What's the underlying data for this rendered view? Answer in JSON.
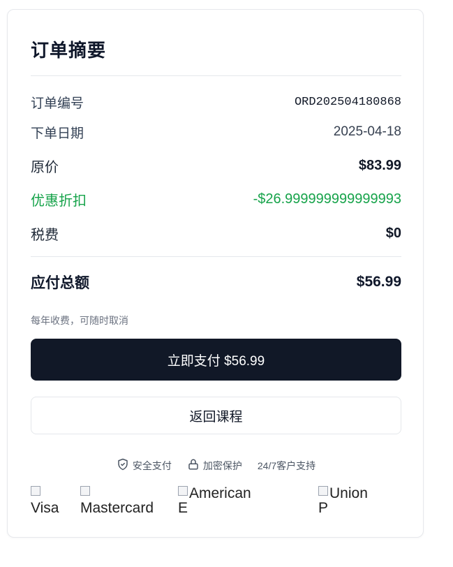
{
  "summary": {
    "title": "订单摘要",
    "rows": [
      {
        "label": "订单编号",
        "value": "ORD202504180868"
      },
      {
        "label": "下单日期",
        "value": "2025-04-18"
      },
      {
        "label": "原价",
        "value": "$83.99"
      },
      {
        "label": "优惠折扣",
        "value": "-$26.999999999999993"
      },
      {
        "label": "税费",
        "value": "$0"
      }
    ],
    "total": {
      "label": "应付总额",
      "value": "$56.99"
    },
    "billing_note": "每年收费，可随时取消"
  },
  "actions": {
    "pay_label": "立即支付 $56.99",
    "back_label": "返回课程"
  },
  "trust": {
    "secure": "安全支付",
    "encrypted": "加密保护",
    "support": "24/7客户支持"
  },
  "payment_logos": {
    "visa": "Visa",
    "mastercard": "Mastercard",
    "amex": "American",
    "amex_cut": "E",
    "unionpay": "Union",
    "unionpay_cut": "P"
  },
  "colors": {
    "primary": "#111827",
    "discount": "#16a34a"
  }
}
